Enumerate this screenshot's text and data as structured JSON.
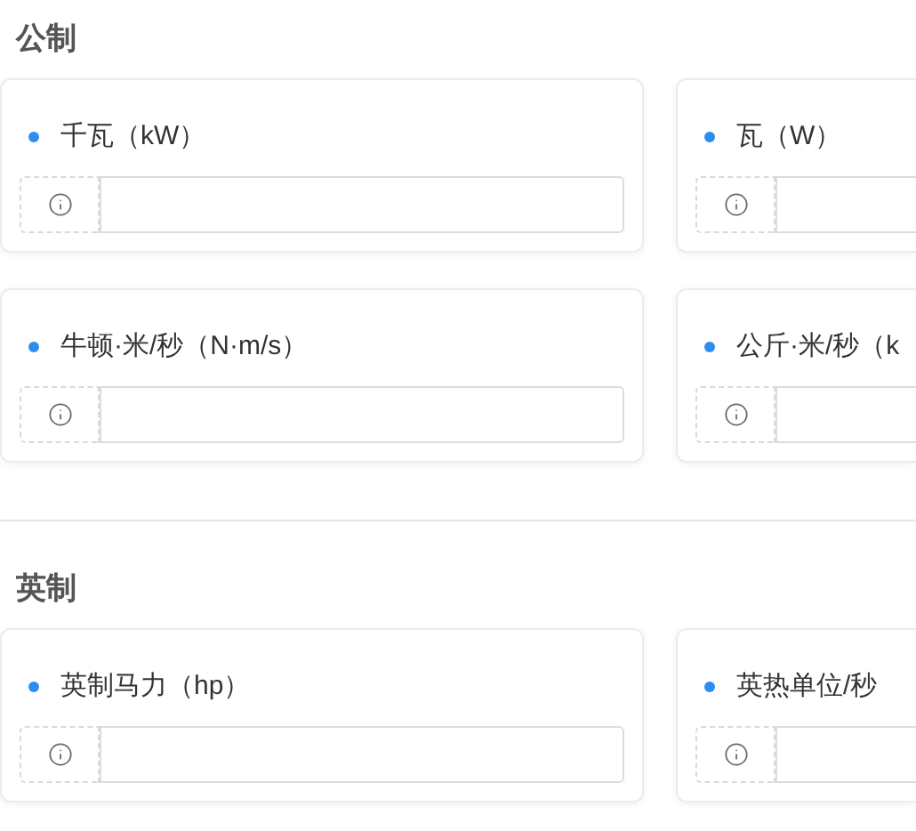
{
  "sections": [
    {
      "title": "公制",
      "cards": [
        {
          "label": "千瓦（kW）"
        },
        {
          "label": "瓦（W）"
        },
        {
          "label": "牛顿·米/秒（N·m/s）"
        },
        {
          "label": "公斤·米/秒（k"
        }
      ]
    },
    {
      "title": "英制",
      "cards": [
        {
          "label": "英制马力（hp）"
        },
        {
          "label": "英热单位/秒"
        }
      ]
    }
  ]
}
